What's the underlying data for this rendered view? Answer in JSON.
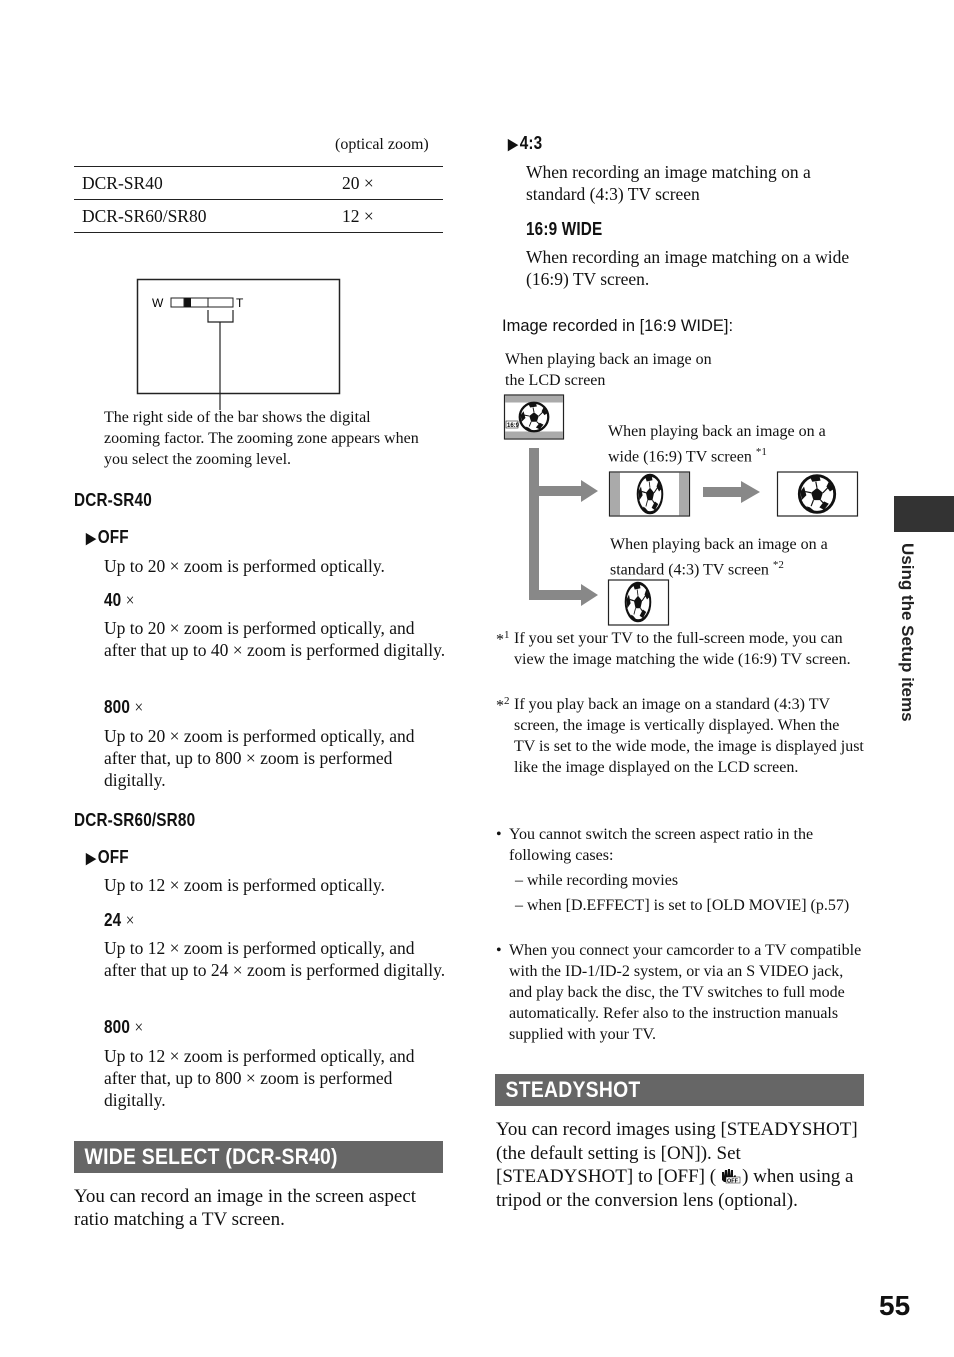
{
  "left": {
    "table_caption": "(optical zoom)",
    "table_rows": [
      {
        "model": "DCR-SR40",
        "zoom": "20 ×"
      },
      {
        "model": "DCR-SR60/SR80",
        "zoom": "12 ×"
      }
    ],
    "diagram_labels": {
      "wide": "W",
      "tele": "T"
    },
    "diagram_caption": "The right side of the bar shows the digital zooming factor. The zooming zone appears when you select the zooming level.",
    "sr40": {
      "heading": "DCR-SR40",
      "options": [
        {
          "label": "OFF",
          "default": true,
          "desc": "Up to 20 × zoom is performed optically."
        },
        {
          "label": "40",
          "desc": "Up to 20 × zoom is performed optically, and after that up to 40 × zoom is performed digitally."
        },
        {
          "label": "800",
          "desc": "Up to 20 × zoom is performed optically, and after that, up to 800 × zoom is performed digitally."
        }
      ]
    },
    "sr60": {
      "heading": "DCR-SR60/SR80",
      "options": [
        {
          "label": "OFF",
          "default": true,
          "desc": "Up to 12 × zoom is performed optically."
        },
        {
          "label": "24",
          "desc": "Up to 12 × zoom is performed optically, and after that up to 24 × zoom is performed digitally."
        },
        {
          "label": "800",
          "desc": "Up to 12 × zoom is performed optically, and after that, up to 800 × zoom is performed digitally."
        }
      ]
    },
    "times_symbol": "×",
    "default_marker": "▶",
    "wide_select": {
      "title": "WIDE SELECT (DCR-SR40)",
      "body": "You can record an image in the screen aspect ratio matching a TV screen."
    }
  },
  "right": {
    "opt_43": {
      "label": "4:3",
      "desc": "When recording an image matching on a standard (4:3) TV screen"
    },
    "opt_169": {
      "label": "16:9 WIDE",
      "desc": "When recording an image matching on a wide (16:9) TV screen."
    },
    "figure_title": "Image recorded in [16:9 WIDE]:",
    "lcd_caption": "When playing back an image on the LCD screen",
    "lcd_badge": "16:9",
    "wide_caption": "When playing back an image on a wide (16:9) TV screen",
    "wide_ref": "*1",
    "std_caption": "When playing back an image on a standard (4:3) TV screen",
    "std_ref": "*2",
    "notes": [
      {
        "mark": "*",
        "num": "1",
        "text": "If you set your TV to the full-screen mode, you can view the image matching the wide (16:9) TV screen."
      },
      {
        "mark": "*",
        "num": "2",
        "text": "If you play back an image on a standard (4:3) TV screen, the image is vertically displayed. When the TV is set to the wide mode, the image is displayed just like the image displayed on the LCD screen."
      }
    ],
    "bullets": [
      {
        "text": "You cannot switch the screen aspect ratio in the following cases:",
        "sub": [
          "– while recording movies",
          "– when [D.EFFECT] is set to [OLD MOVIE] (p.57)"
        ]
      },
      {
        "text": "When you connect your camcorder to a TV compatible with the ID-1/ID-2 system, or via an S VIDEO jack, and play back the disc, the TV switches to full mode automatically. Refer also to the instruction manuals supplied with your TV.",
        "sub": []
      }
    ],
    "steadyshot": {
      "title": "STEADYSHOT",
      "body_before": "You can record images using [STEADYSHOT] (the default setting is [ON]). Set [STEADYSHOT] to [OFF] (",
      "body_after": ") when using a tripod or the conversion lens (optional).",
      "icon_label": "OFF"
    }
  },
  "side_tab": "Using the Setup items",
  "page_number": "55"
}
